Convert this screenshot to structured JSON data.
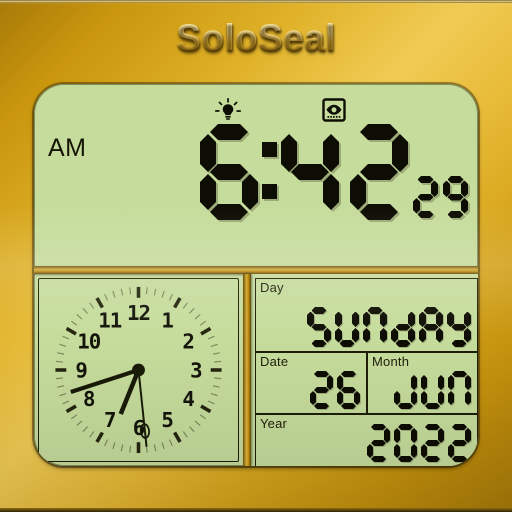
{
  "device": {
    "brand": "SoloSeal",
    "frame_color": "#d6a41a",
    "lcd_color": "#c6dc9c",
    "segment_color": "#0d0d03"
  },
  "indicators": [
    {
      "name": "backlight-icon",
      "icon": "light-bulb",
      "active": true
    },
    {
      "name": "display-eye-icon",
      "icon": "eye-in-box",
      "active": true
    }
  ],
  "time": {
    "meridiem": "AM",
    "hours": "6",
    "separator": ":",
    "minutes": "42",
    "seconds": "29"
  },
  "analog_clock": {
    "numerals": [
      "12",
      "1",
      "2",
      "3",
      "4",
      "5",
      "6",
      "7",
      "8",
      "9",
      "10",
      "11"
    ],
    "hour_hand_deg": 202,
    "minute_hand_deg": 252,
    "second_hand_deg": 174
  },
  "date_panel": {
    "day": {
      "label": "Day",
      "value": "SUNDAY"
    },
    "date": {
      "label": "Date",
      "value": "26"
    },
    "month": {
      "label": "Month",
      "value": "JUN"
    },
    "year": {
      "label": "Year",
      "value": "2022"
    }
  }
}
